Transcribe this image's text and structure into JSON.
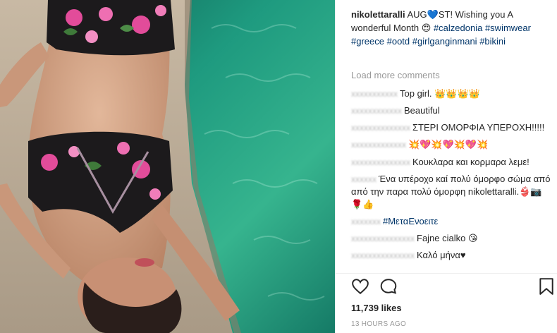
{
  "post": {
    "username": "nikolettaralli",
    "caption_parts": [
      "AUG",
      "💙",
      "ST! Wishing you A wonderful Month",
      "😍",
      " "
    ],
    "hashtags": [
      "#calzedonia",
      "#swimwear",
      "#greece",
      "#ootd",
      "#girlganginmani",
      "#bikini"
    ]
  },
  "load_more": "Load more comments",
  "comments": [
    {
      "text": "Top girl. 👑👑👑👑"
    },
    {
      "text": "Beautiful"
    },
    {
      "text": "ΣΤΕΡΙ ΟΜΟΡΦΙΑ ΥΠΕΡΟΧΗ!!!!!"
    },
    {
      "text": "💥💖💥💖💥💖💥"
    },
    {
      "text": "Κουκλαρα και κορμαρα λεμε!"
    },
    {
      "text": "Ένα υπέροχο καί πολύ όμορφο σώμα από από την παρα πολύ όμορφη nikolettaralli.👙📷🌹👍"
    },
    {
      "text": "#ΜεταΕνοειτε",
      "is_tag": true
    },
    {
      "text": "Fajne cialko 😘"
    },
    {
      "text": "Καλό μήνα♥"
    }
  ],
  "icons": {
    "like": "heart-outline-icon",
    "comment": "comment-bubble-icon",
    "save": "bookmark-icon"
  },
  "likes": "11,739 likes",
  "timestamp": "13 HOURS AGO",
  "colors": {
    "link": "#003569",
    "muted": "#999999",
    "water": "#1f9e83"
  }
}
